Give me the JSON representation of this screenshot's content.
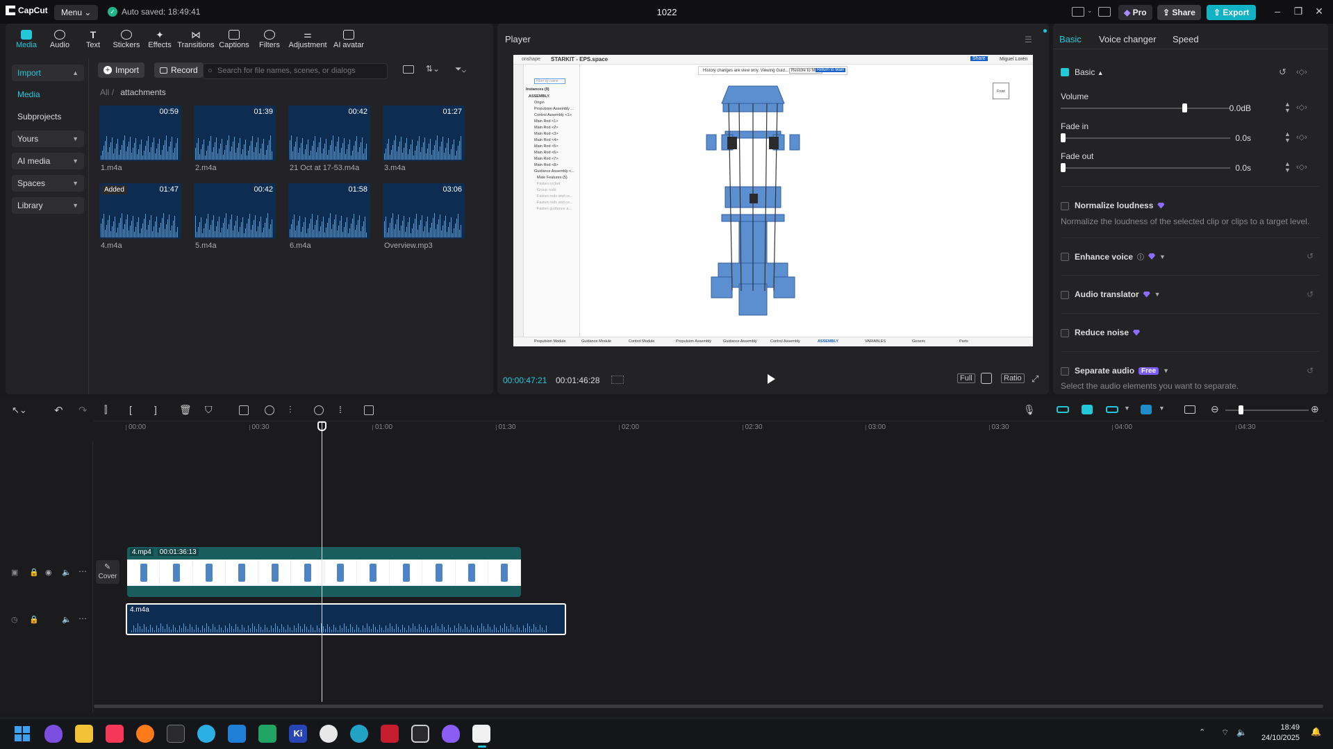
{
  "app": {
    "name": "CapCut",
    "menu_label": "Menu",
    "autosave": "Auto saved: 18:49:41",
    "project_title": "1022",
    "pro_label": "Pro",
    "share_label": "Share",
    "export_label": "Export"
  },
  "tool_tabs": [
    {
      "label": "Media",
      "icon": "media-icon"
    },
    {
      "label": "Audio",
      "icon": "audio-icon"
    },
    {
      "label": "Text",
      "icon": "text-icon"
    },
    {
      "label": "Stickers",
      "icon": "stickers-icon"
    },
    {
      "label": "Effects",
      "icon": "effects-icon"
    },
    {
      "label": "Transitions",
      "icon": "transitions-icon"
    },
    {
      "label": "Captions",
      "icon": "captions-icon"
    },
    {
      "label": "Filters",
      "icon": "filters-icon"
    },
    {
      "label": "Adjustment",
      "icon": "adjustment-icon"
    },
    {
      "label": "AI avatar",
      "icon": "ai-avatar-icon"
    }
  ],
  "side_nav": {
    "import": "Import",
    "media": "Media",
    "subprojects": "Subprojects",
    "yours": "Yours",
    "ai_media": "AI media",
    "spaces": "Spaces",
    "library": "Library"
  },
  "media_toolbar": {
    "import": "Import",
    "record": "Record",
    "search_placeholder": "Search for file names, scenes, or dialogs"
  },
  "breadcrumb": {
    "root": "All",
    "sep": "/",
    "folder": "attachments"
  },
  "media_items": [
    {
      "name": "1.m4a",
      "duration": "00:59",
      "added": ""
    },
    {
      "name": "2.m4a",
      "duration": "01:39",
      "added": ""
    },
    {
      "name": "21 Oct at 17-53.m4a",
      "duration": "00:42",
      "added": ""
    },
    {
      "name": "3.m4a",
      "duration": "01:27",
      "added": ""
    },
    {
      "name": "4.m4a",
      "duration": "01:47",
      "added": "Added"
    },
    {
      "name": "5.m4a",
      "duration": "00:42",
      "added": ""
    },
    {
      "name": "6.m4a",
      "duration": "01:58",
      "added": ""
    },
    {
      "name": "Overview.mp3",
      "duration": "03:06",
      "added": ""
    }
  ],
  "player": {
    "title": "Player",
    "current_time": "00:00:47:21",
    "total_time": "00:01:46:28",
    "full": "Full",
    "ratio": "Ratio"
  },
  "player_frame": {
    "app_name": "onshape",
    "doc_title": "STARKIT - EPS.space",
    "banner": "History changes are view only. Viewing Guid...",
    "restore": "Restore to Main",
    "return": "Return to Main",
    "share": "Share",
    "user": "Miguel Lorén",
    "filter_placeholder": "Filter by name",
    "instances": "Instances (9)",
    "assembly": "ASSEMBLY",
    "tree": [
      "Origin",
      "Propulsion Assembly ...",
      "Control Assembly <1>",
      "Main Rod <1>",
      "Main Rod <2>",
      "Main Rod <3>",
      "Main Rod <4>",
      "Main Rod <5>",
      "Main Rod <6>",
      "Main Rod <7>",
      "Main Rod <8>",
      "Guidance Assembly <...",
      "Mate Features (5)",
      "Fasten rocket",
      "Group rods",
      "Fasten rods and ce...",
      "Fasten rods and ce...",
      "Fasten guidance a..."
    ],
    "bottom_tabs": [
      "Propulsion Module",
      "Guidance Module",
      "Control Module",
      "Propulsion Assembly",
      "Guidance Assembly",
      "Control Assembly",
      "ASSEMBLY",
      "VARIABLES",
      "Generic",
      "Parts"
    ]
  },
  "right_panel": {
    "tabs": [
      "Basic",
      "Voice changer",
      "Speed"
    ],
    "basic_header": "Basic",
    "volume": {
      "label": "Volume",
      "value": "0.0dB",
      "level": 0.73
    },
    "fade_in": {
      "label": "Fade in",
      "value": "0.0s",
      "level": 0
    },
    "fade_out": {
      "label": "Fade out",
      "value": "0.0s",
      "level": 0
    },
    "normalize": {
      "label": "Normalize loudness",
      "hint": "Normalize the loudness of the selected clip or clips to a target level."
    },
    "enhance_voice": "Enhance voice",
    "audio_translator": "Audio translator",
    "reduce_noise": "Reduce noise",
    "separate_audio": {
      "label": "Separate audio",
      "badge": "Free",
      "hint": "Select the audio elements you want to separate."
    }
  },
  "timeline": {
    "ruler": [
      "00:00",
      "00:30",
      "01:00",
      "01:30",
      "02:00",
      "02:30",
      "03:00",
      "03:30",
      "04:00",
      "04:30"
    ],
    "video_clip": {
      "name": "4.mp4",
      "duration": "00:01:36:13"
    },
    "audio_clip": {
      "name": "4.m4a"
    },
    "cover_label": "Cover"
  },
  "taskbar": {
    "time": "18:49",
    "date": "24/10/2025"
  },
  "colors": {
    "accent": "#22c8d8",
    "export": "#10b2c4",
    "clip_video": "#1a5d5f",
    "clip_audio": "#0d2c52"
  }
}
